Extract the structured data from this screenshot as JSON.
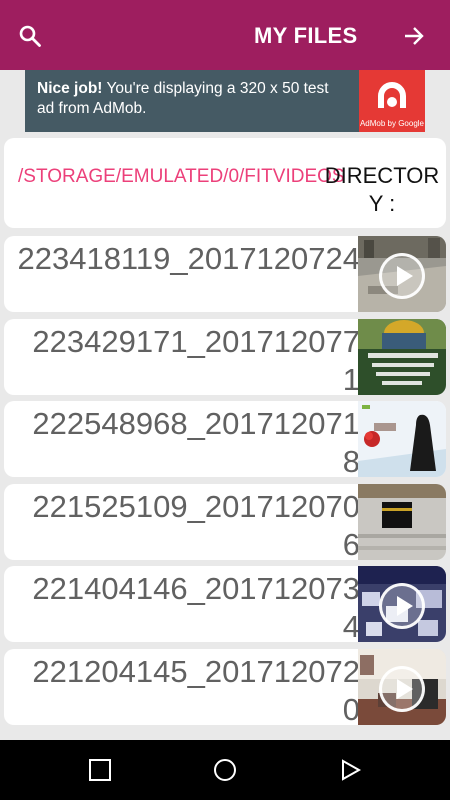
{
  "appbar": {
    "title": "MY FILES",
    "left_icon": "search-icon",
    "right_icon": "arrow-forward-icon",
    "color": "#9e1e5f"
  },
  "ad": {
    "bold": "Nice job!",
    "text": " You're displaying a 320 x 50 test ad from AdMob.",
    "logo_caption": "AdMob by Google",
    "bg_color": "#455a64",
    "logo_color": "#e53935"
  },
  "directory": {
    "path": "/STORAGE/EMULATED/0/FITVIDEOS",
    "label": "DIRECTORY :",
    "path_color": "#ec407a"
  },
  "files": [
    {
      "name": "223418119_2017120724",
      "thumb": "video-thumbnail-mosque-courtyard",
      "has_play": true
    },
    {
      "name": "223429171_2017120771",
      "thumb": "image-thumbnail-dome-arabic-text",
      "has_play": false
    },
    {
      "name": "222548968_2017120718",
      "thumb": "image-thumbnail-rose-woman",
      "has_play": false
    },
    {
      "name": "221525109_2017120706",
      "thumb": "image-thumbnail-kaaba",
      "has_play": false
    },
    {
      "name": "221404146_2017120734",
      "thumb": "video-thumbnail-crowd",
      "has_play": true
    },
    {
      "name": "221204145_2017120720",
      "thumb": "video-thumbnail-prayer-room",
      "has_play": true
    }
  ],
  "navbar": {
    "icons": [
      "recents-square-icon",
      "home-circle-icon",
      "back-triangle-icon"
    ]
  }
}
